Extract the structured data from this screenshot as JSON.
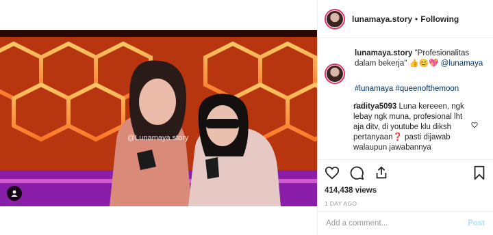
{
  "post": {
    "watermark": "@Lunamaya.story"
  },
  "header": {
    "username": "lunamaya.story",
    "separator": "•",
    "follow_status": "Following"
  },
  "caption": {
    "username": "lunamaya.story",
    "text": "\"Profesionalitas dalam bekerja\" 👍😊💖",
    "mention": "@lunamaya",
    "hashtags": "#lunamaya #queenofthemoon",
    "time": "1d"
  },
  "comments": [
    {
      "username": "raditya5093",
      "text": "Luna kereeen, ngk lebay ngk muna, profesional lht aja ditv, di youtube klu diksh pertanyaan❓ pasti dijawab walaupun jawabannya"
    }
  ],
  "actions": {
    "views": "414,438 views",
    "posted_ago": "1 DAY AGO"
  },
  "add_comment": {
    "placeholder": "Add a comment...",
    "post_label": "Post"
  },
  "colors": {
    "link": "#003569",
    "post_button_disabled": "#b2dffc",
    "story_ring": "#e1306c"
  }
}
